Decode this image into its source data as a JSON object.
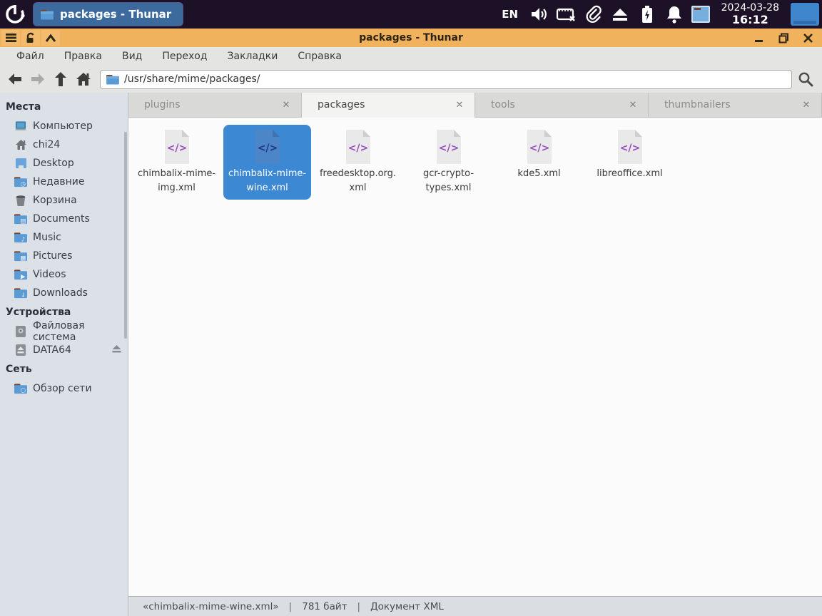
{
  "panel": {
    "logo": "chimbalix-logo-icon",
    "taskbar_button": {
      "label": "packages - Thunar",
      "icon": "folder-icon"
    },
    "language_indicator": "EN",
    "tray": [
      "volume-icon",
      "keyboard-off-icon",
      "attachment-icon",
      "eject-icon",
      "battery-charging-icon",
      "notifications-bell-icon",
      "tray-app-icon"
    ],
    "clock": {
      "date": "2024-03-28",
      "time": "16:12"
    }
  },
  "window": {
    "title": "packages - Thunar",
    "titlebar_left_buttons": [
      "window-menu-icon",
      "unlock-icon",
      "rollup-icon"
    ],
    "controls": {
      "minimize": "minimize-icon",
      "maximize": "restore-icon",
      "close": "close-icon"
    }
  },
  "menubar": {
    "items": [
      "Файл",
      "Правка",
      "Вид",
      "Переход",
      "Закладки",
      "Справка"
    ]
  },
  "toolbar": {
    "buttons": [
      "back-icon",
      "forward-icon",
      "up-icon",
      "home-icon"
    ],
    "path": "/usr/share/mime/packages/",
    "path_icon": "folder-icon",
    "search_icon": "search-icon"
  },
  "tabs": [
    {
      "label": "plugins",
      "active": false
    },
    {
      "label": "packages",
      "active": true
    },
    {
      "label": "tools",
      "active": false
    },
    {
      "label": "thumbnailers",
      "active": false
    }
  ],
  "sidebar": {
    "sections": [
      {
        "header": "Места",
        "items": [
          {
            "label": "Компьютер",
            "icon": "computer-icon"
          },
          {
            "label": "chi24",
            "icon": "home-small-icon"
          },
          {
            "label": "Desktop",
            "icon": "desktop-icon"
          },
          {
            "label": "Недавние",
            "icon": "folder-recent-icon"
          },
          {
            "label": "Корзина",
            "icon": "trash-icon"
          },
          {
            "label": "Documents",
            "icon": "folder-documents-icon"
          },
          {
            "label": "Music",
            "icon": "folder-music-icon"
          },
          {
            "label": "Pictures",
            "icon": "folder-pictures-icon"
          },
          {
            "label": "Videos",
            "icon": "folder-videos-icon"
          },
          {
            "label": "Downloads",
            "icon": "folder-downloads-icon"
          }
        ]
      },
      {
        "header": "Устройства",
        "items": [
          {
            "label": "Файловая система",
            "icon": "harddisk-icon"
          },
          {
            "label": "DATA64",
            "icon": "removable-drive-icon",
            "eject": true
          }
        ]
      },
      {
        "header": "Сеть",
        "items": [
          {
            "label": "Обзор сети",
            "icon": "folder-network-icon"
          }
        ]
      }
    ]
  },
  "files": [
    {
      "name": "chimbalix-mime-img.xml",
      "label_lines": [
        "chimbalix-mime-",
        "img.xml"
      ],
      "icon": "xml-file-icon",
      "selected": false
    },
    {
      "name": "chimbalix-mime-wine.xml",
      "label_lines": [
        "chimbalix-mime-",
        "wine.xml"
      ],
      "icon": "xml-file-icon",
      "selected": true
    },
    {
      "name": "freedesktop.org.xml",
      "label_lines": [
        "freedesktop.org.",
        "xml"
      ],
      "icon": "xml-file-icon",
      "selected": false
    },
    {
      "name": "gcr-crypto-types.xml",
      "label_lines": [
        "gcr-crypto-",
        "types.xml"
      ],
      "icon": "xml-file-icon",
      "selected": false
    },
    {
      "name": "kde5.xml",
      "label_lines": [
        "kde5.xml"
      ],
      "icon": "xml-file-icon",
      "selected": false
    },
    {
      "name": "libreoffice.xml",
      "label_lines": [
        "libreoffice.xml"
      ],
      "icon": "xml-file-icon",
      "selected": false
    }
  ],
  "statusbar": {
    "selection": "«chimbalix-mime-wine.xml»",
    "separator": "|",
    "size": "781 байт",
    "type": "Документ XML"
  },
  "colors": {
    "panel_bg": "#1d1127",
    "titlebar_bg": "#f0b25c",
    "selection_blue": "#3d88d3",
    "taskbar_button_bg": "#3d6a9d",
    "sidebar_bg": "#dce1e7",
    "xml_glyph_purple": "#9a4fc0"
  }
}
